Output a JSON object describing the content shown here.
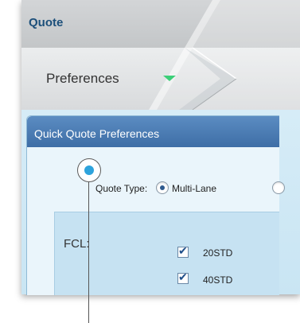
{
  "app": {
    "title": "Quote"
  },
  "preferences_tab": {
    "label": "Preferences",
    "icon": "triangle-down-icon",
    "icon_color": "#3ccf78"
  },
  "dialog": {
    "title": "Quick Quote Preferences",
    "quote_type": {
      "label": "Quote Type:",
      "selected": "Multi-Lane",
      "options": [
        "Multi-Lane"
      ]
    },
    "fcl": {
      "label": "FCL:",
      "options": [
        {
          "label": "20STD",
          "checked": true
        },
        {
          "label": "40STD",
          "checked": true
        }
      ]
    }
  },
  "colors": {
    "title": "#1c4f7a",
    "dialog_header": "#4a7bb4",
    "callout_dot": "#2ea3dc"
  }
}
